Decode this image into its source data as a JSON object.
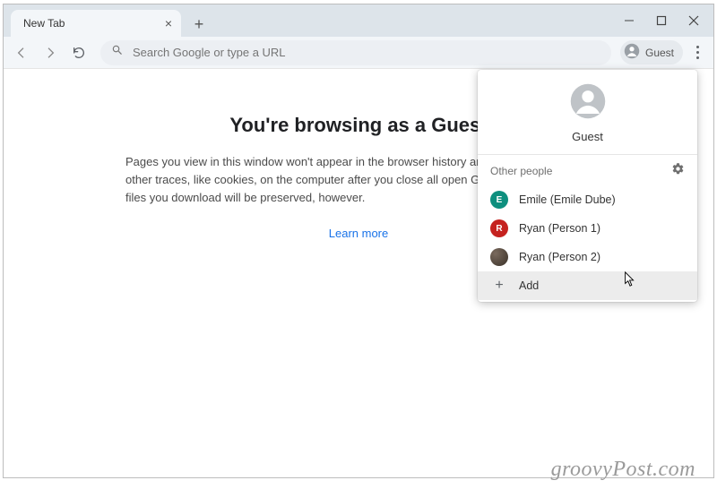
{
  "tab": {
    "title": "New Tab"
  },
  "omnibox": {
    "placeholder": "Search Google or type a URL"
  },
  "profile_chip": {
    "label": "Guest"
  },
  "content": {
    "heading": "You're browsing as a Guest",
    "body": "Pages you view in this window won't appear in the browser history and they won't leave other traces, like cookies, on the computer after you close all open Guest windows. Any files you download will be preserved, however.",
    "link": "Learn more"
  },
  "popup": {
    "current_name": "Guest",
    "section_label": "Other people",
    "people": [
      {
        "initial": "E",
        "label": "Emile (Emile Dube)",
        "color": "teal"
      },
      {
        "initial": "R",
        "label": "Ryan (Person 1)",
        "color": "red"
      },
      {
        "initial": "",
        "label": "Ryan (Person 2)",
        "color": "img"
      }
    ],
    "add_label": "Add"
  },
  "watermark": "groovyPost.com"
}
